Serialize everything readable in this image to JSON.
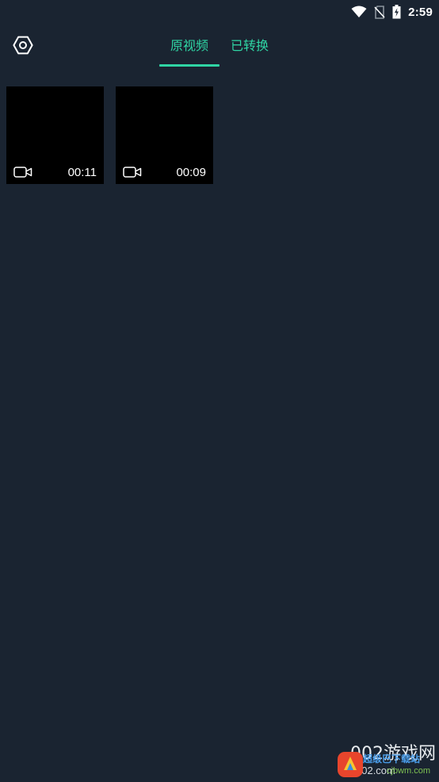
{
  "status_bar": {
    "time": "2:59",
    "icons": [
      "wifi-icon",
      "no-sim-icon",
      "battery-charging-icon"
    ]
  },
  "header": {
    "settings_icon": "settings-hexagon-icon",
    "tabs": [
      {
        "label": "原视频",
        "active": true
      },
      {
        "label": "已转换",
        "active": false
      }
    ],
    "accent_color": "#2fd5a4"
  },
  "videos": [
    {
      "duration": "00:11",
      "icon": "video-camera-icon"
    },
    {
      "duration": "00:09",
      "icon": "video-camera-icon"
    }
  ],
  "watermark": {
    "line1": "002游戏网",
    "line2": "yx002.com",
    "site_name": "超级巴下载站",
    "site_url": "cjbwm.com"
  },
  "colors": {
    "background": "#1a2431",
    "thumbnail": "#000000",
    "text": "#ffffff"
  }
}
